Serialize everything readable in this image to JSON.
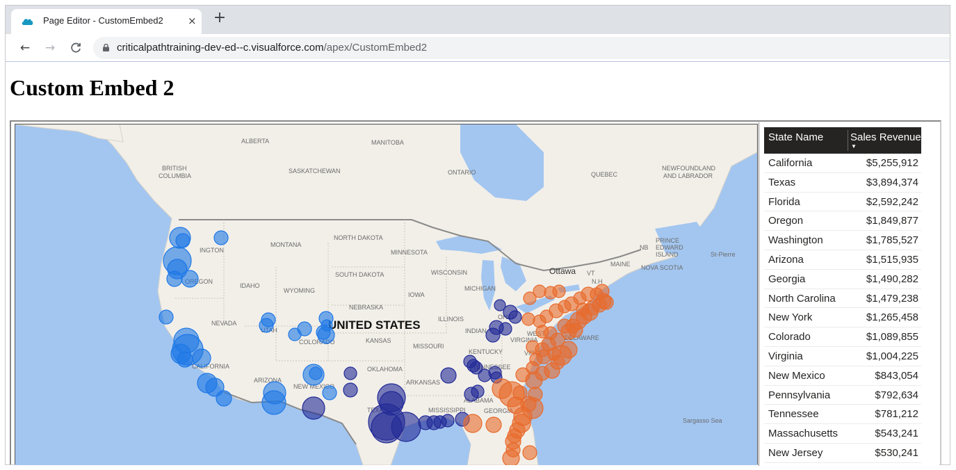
{
  "browser": {
    "tab_title": "Page Editor - CustomEmbed2",
    "tab_close": "×",
    "new_tab": "+",
    "url_host": "criticalpathtraining-dev-ed--c.visualforce.com",
    "url_path": "/apex/CustomEmbed2"
  },
  "page": {
    "title": "Custom Embed 2"
  },
  "map": {
    "labels": {
      "alberta": "ALBERTA",
      "manitoba": "MANITOBA",
      "british_columbia_1": "BRITISH",
      "british_columbia_2": "COLUMBIA",
      "saskatchewan": "SASKATCHEWAN",
      "ontario": "ONTARIO",
      "quebec": "QUEBEC",
      "newfoundland_1": "NEWFOUNDLAND",
      "newfoundland_2": "AND LABRADOR",
      "washington": "INGTON",
      "montana": "MONTANA",
      "north_dakota": "NORTH DAKOTA",
      "minnesota": "MINNESOTA",
      "nb": "NB",
      "pei_1": "PRINCE",
      "pei_2": "EDWARD",
      "pei_3": "ISLAND",
      "st_pierre": "St-Pierre",
      "oregon": "OREGON",
      "idaho": "IDAHO",
      "south_dakota": "SOUTH DAKOTA",
      "wisconsin": "WISCONSIN",
      "ottawa": "Ottawa",
      "maine": "MAINE",
      "nova_scotia": "NOVA SCOTIA",
      "vt": "VT",
      "nh": "N.H",
      "wyoming": "WYOMING",
      "michigan": "MICHIGAN",
      "iowa": "IOWA",
      "nebraska": "NEBRASKA",
      "nevada": "NEVADA",
      "utah": "UTAH",
      "united_states": "UNITED STATES",
      "illinois": "ILLINOIS",
      "indiana": "INDIAN",
      "ohio": "OHIO",
      "colorado": "COLORADO",
      "kansas": "KANSAS",
      "missouri": "MISSOURI",
      "west_virginia_1": "WEST",
      "west_virginia_2": "VIRGINIA",
      "delaware": "DELAWARE",
      "kentucky": "KENTUCKY",
      "virginia": "VIRGI",
      "california": "CALIFORNIA",
      "oklahoma": "OKLAHOMA",
      "tennessee": "TENNESSEE",
      "arizona": "ARIZONA",
      "new_mexico": "NEW MEXICO",
      "arkansas": "ARKANSAS",
      "alabama": "ALABAMA",
      "mississippi": "MISSISSIPPI",
      "georgia": "GEORGIA",
      "texas": "TEXAS",
      "sargasso": "Sargasso Sea"
    },
    "colors": {
      "water": "#a3c6f0",
      "land": "#f2efe9",
      "west": "#1e78e6",
      "central": "#222a96",
      "east": "#e86a2b"
    }
  },
  "table": {
    "col_state": "State Name",
    "col_revenue": "Sales Revenue",
    "sort_icon": "▼",
    "rows": [
      {
        "state": "California",
        "revenue": "$5,255,912"
      },
      {
        "state": "Texas",
        "revenue": "$3,894,374"
      },
      {
        "state": "Florida",
        "revenue": "$2,592,242"
      },
      {
        "state": "Oregon",
        "revenue": "$1,849,877"
      },
      {
        "state": "Washington",
        "revenue": "$1,785,527"
      },
      {
        "state": "Arizona",
        "revenue": "$1,515,935"
      },
      {
        "state": "Georgia",
        "revenue": "$1,490,282"
      },
      {
        "state": "North Carolina",
        "revenue": "$1,479,238"
      },
      {
        "state": "New York",
        "revenue": "$1,265,458"
      },
      {
        "state": "Colorado",
        "revenue": "$1,089,855"
      },
      {
        "state": "Virginia",
        "revenue": "$1,004,225"
      },
      {
        "state": "New Mexico",
        "revenue": "$843,054"
      },
      {
        "state": "Pennsylvania",
        "revenue": "$792,634"
      },
      {
        "state": "Tennessee",
        "revenue": "$781,212"
      },
      {
        "state": "Massachusetts",
        "revenue": "$543,241"
      },
      {
        "state": "New Jersey",
        "revenue": "$530,241"
      }
    ]
  }
}
